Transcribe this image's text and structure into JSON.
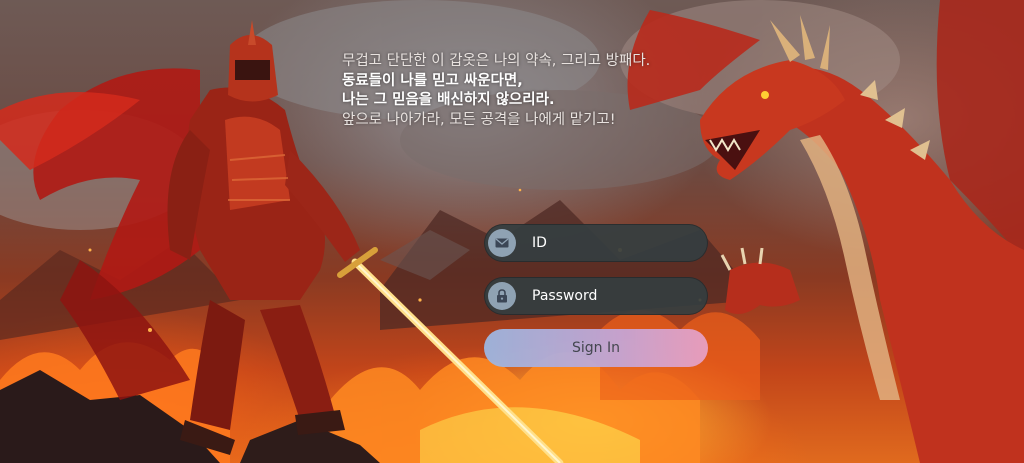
{
  "poem": {
    "lines": [
      "무겁고 단단한 이 갑옷은 나의 약속, 그리고 방패다.",
      "동료들이 나를 믿고 싸운다면,",
      "나는 그 믿음을 배신하지 않으리라.",
      "앞으로 나아가라, 모든 공격을 나에게 맡기고!"
    ]
  },
  "login": {
    "id_placeholder": "ID",
    "password_placeholder": "Password",
    "signin_label": "Sign In",
    "id_icon": "envelope-icon",
    "password_icon": "lock-icon"
  },
  "colors": {
    "field_bg": "#343e40",
    "icon_bg": "#8fa2b3",
    "button_gradient_start": "#9cb6e0",
    "button_gradient_end": "#e89fc2"
  }
}
